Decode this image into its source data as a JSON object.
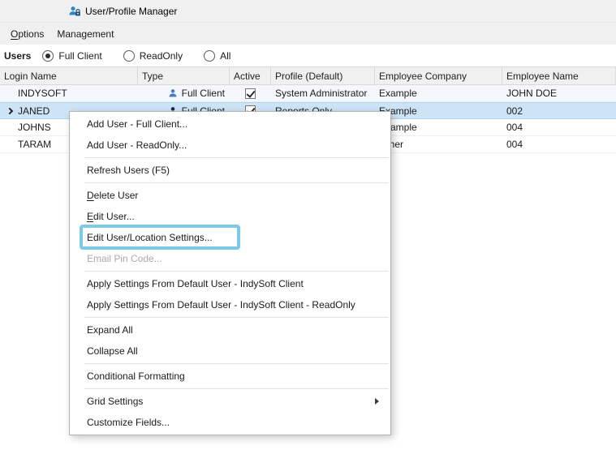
{
  "window": {
    "title": "User/Profile Manager"
  },
  "menubar": {
    "items": [
      {
        "label": "Options",
        "underline_first": true
      },
      {
        "label": "Management",
        "underline_first": false
      }
    ]
  },
  "filter": {
    "label": "Users",
    "options": [
      {
        "label": "Full Client",
        "selected": true
      },
      {
        "label": "ReadOnly",
        "selected": false
      },
      {
        "label": "All",
        "selected": false
      }
    ]
  },
  "grid": {
    "columns": [
      "Login Name",
      "Type",
      "Active",
      "Profile (Default)",
      "Employee Company",
      "Employee Name"
    ],
    "rows": [
      {
        "login": "INDYSOFT",
        "type": "Full Client",
        "icon_color": "#4a7dbe",
        "active": true,
        "profile": "System Administrator",
        "company": "Example",
        "employee": "JOHN DOE",
        "selected": false,
        "alt": true
      },
      {
        "login": "JANED",
        "type": "Full Client",
        "icon_color": "#23283a",
        "active": true,
        "profile": "Reports Only",
        "company": "Example",
        "employee": "002",
        "selected": true,
        "alt": false
      },
      {
        "login": "JOHNS",
        "type": null,
        "icon_color": null,
        "active": null,
        "profile": "",
        "company": "Example",
        "employee": "004",
        "selected": false,
        "alt": false
      },
      {
        "login": "TARAM",
        "type": null,
        "icon_color": null,
        "active": null,
        "profile": "",
        "company": "Other",
        "employee": "004",
        "selected": false,
        "alt": false
      }
    ]
  },
  "context_menu": {
    "items": [
      {
        "type": "item",
        "label": "Add User - Full Client..."
      },
      {
        "type": "item",
        "label": "Add User - ReadOnly..."
      },
      {
        "type": "separator"
      },
      {
        "type": "item",
        "label": "Refresh Users (F5)"
      },
      {
        "type": "separator"
      },
      {
        "type": "item",
        "label": "Delete User",
        "underline_first": true
      },
      {
        "type": "item",
        "label": "Edit User...",
        "underline_first": true
      },
      {
        "type": "item",
        "label": "Edit User/Location Settings...",
        "annotated": true
      },
      {
        "type": "item",
        "label": "Email Pin Code...",
        "disabled": true
      },
      {
        "type": "separator"
      },
      {
        "type": "item",
        "label": "Apply Settings From Default User - IndySoft Client"
      },
      {
        "type": "item",
        "label": "Apply Settings From Default User - IndySoft Client - ReadOnly"
      },
      {
        "type": "separator"
      },
      {
        "type": "item",
        "label": "Expand All"
      },
      {
        "type": "item",
        "label": "Collapse All"
      },
      {
        "type": "separator"
      },
      {
        "type": "item",
        "label": "Conditional Formatting"
      },
      {
        "type": "separator"
      },
      {
        "type": "item",
        "label": "Grid Settings",
        "submenu": true
      },
      {
        "type": "item",
        "label": "Customize Fields..."
      }
    ]
  },
  "colors": {
    "annotation_highlight": "#7cc9e8",
    "selected_row": "#cde4f7",
    "app_icon_blue": "#2e86c8",
    "app_icon_dark": "#1b4f7a"
  }
}
